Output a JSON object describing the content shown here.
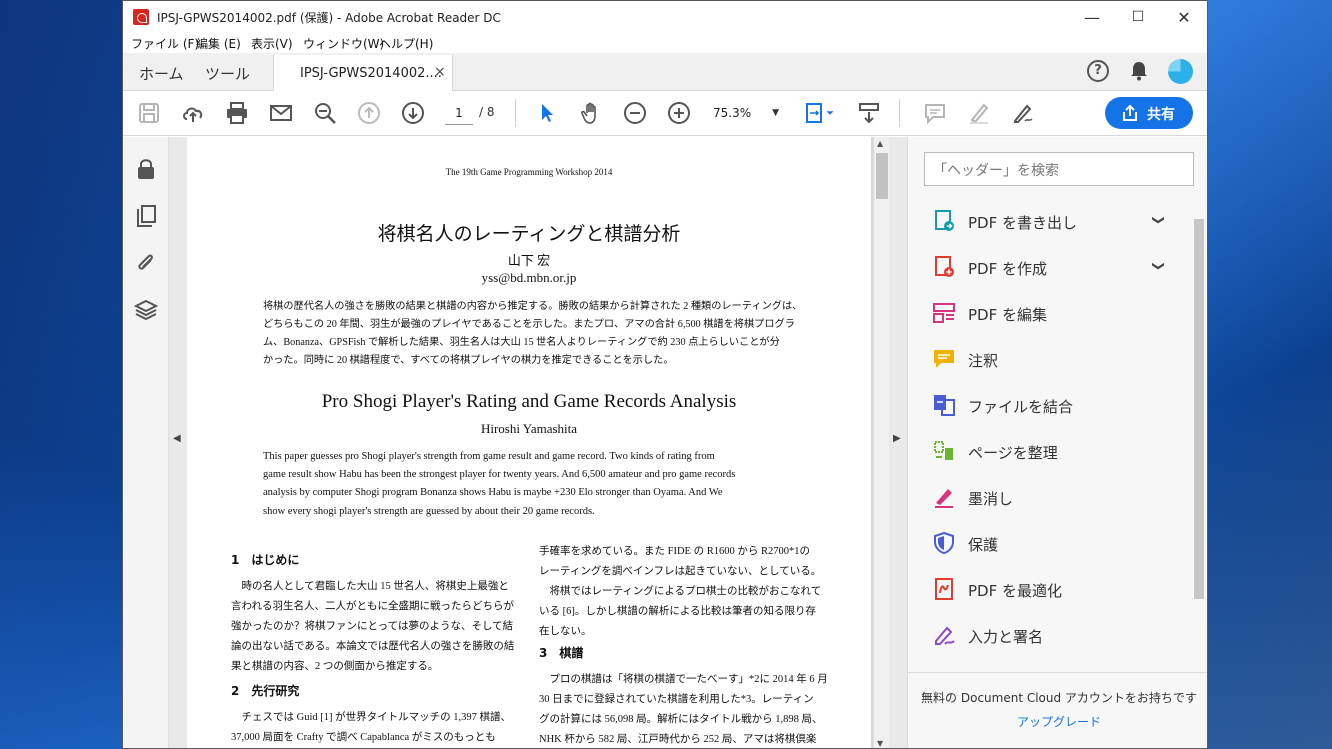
{
  "window": {
    "title": "IPSJ-GPWS2014002.pdf (保護) - Adobe Acrobat Reader DC",
    "controls": {
      "minimize": "—",
      "maximize": "☐",
      "close": "✕"
    }
  },
  "menu": [
    "ファイル (F)",
    "編集 (E)",
    "表示(V)",
    "ウィンドウ(W)",
    "ヘルプ(H)"
  ],
  "tabs": {
    "home": "ホーム",
    "tools": "ツール",
    "document": "IPSJ-GPWS2014002....",
    "close": "×"
  },
  "header_right": {
    "help": "?"
  },
  "toolbar": {
    "page_current": "1",
    "page_total": "/ 8",
    "zoom": "75.3%",
    "zoom_caret": "▼",
    "share_label": "共有"
  },
  "right_pane": {
    "search_placeholder": "「ヘッダー」を検索",
    "items": [
      {
        "label": "PDF を書き出し",
        "icon": "export-pdf-icon",
        "color": "#1a9ba8",
        "expand": "❯"
      },
      {
        "label": "PDF を作成",
        "icon": "create-pdf-icon",
        "color": "#e03c31",
        "expand": "❯"
      },
      {
        "label": "PDF を編集",
        "icon": "edit-pdf-icon",
        "color": "#d6357d"
      },
      {
        "label": "注釈",
        "icon": "comment-icon",
        "color": "#f0b400"
      },
      {
        "label": "ファイルを結合",
        "icon": "combine-files-icon",
        "color": "#4b5bd4"
      },
      {
        "label": "ページを整理",
        "icon": "organize-pages-icon",
        "color": "#6bb52f"
      },
      {
        "label": "墨消し",
        "icon": "redact-icon",
        "color": "#d6357d"
      },
      {
        "label": "保護",
        "icon": "protect-icon",
        "color": "#4b5bd4"
      },
      {
        "label": "PDF を最適化",
        "icon": "optimize-pdf-icon",
        "color": "#e03c31"
      },
      {
        "label": "入力と署名",
        "icon": "fill-sign-icon",
        "color": "#8c4cc9"
      }
    ],
    "footer_text": "無料の Document Cloud アカウントをお持ちです",
    "upgrade": "アップグレード"
  },
  "document": {
    "header": "The 19th Game Programming Workshop 2014",
    "title_jp": "将棋名人のレーティングと棋譜分析",
    "author_jp": "山下 宏",
    "email": "yss@bd.mbn.or.jp",
    "abstract_jp": [
      "将棋の歴代名人の強さを勝敗の結果と棋譜の内容から推定する。勝敗の結果から計算された 2 種類のレーティングは、",
      "どちらもこの 20 年間、羽生が最強のプレイヤであることを示した。またプロ、アマの合計 6,500 棋譜を将棋プログラ",
      "ム、Bonanza、GPSFish で解析した結果、羽生名人は大山 15 世名人よりレーティングで約 230 点上らしいことが分",
      "かった。同時に 20 棋譜程度で、すべての将棋プレイヤの棋力を推定できることを示した。"
    ],
    "title_en": "Pro Shogi Player's Rating and Game Records Analysis",
    "author_en": "Hiroshi Yamashita",
    "abstract_en": [
      "This paper guesses pro Shogi player's strength from game result and game record.  Two kinds of rating from",
      "game result show Habu has been the strongest player for twenty years. And 6,500 amateur and pro game records",
      "analysis by computer Shogi program Bonanza shows Habu is maybe +230 Elo stronger than Oyama.  And We",
      "show every shogi player's strength are guessed by about their 20 game records."
    ],
    "sec1_title": "1　はじめに",
    "sec1_body": [
      "　時の名人として君臨した大山 15 世名人、将棋史上最強と",
      "言われる羽生名人、二人がともに全盛期に戦ったらどちらが",
      "強かったのか？将棋ファンにとっては夢のような、そして結",
      "論の出ない話である。本論文では歴代名人の強さを勝敗の結",
      "果と棋譜の内容、2 つの側面から推定する。"
    ],
    "sec2_title": "2　先行研究",
    "sec2_body": [
      "　チェスでは Guid [1] が世界タイトルマッチの 1,397 棋譜、",
      "37,000 局面を Crafty で調べ Capablanca がミスのもっとも"
    ],
    "col2_top": [
      "手確率を求めている。また FIDE の R1600 から R2700*1の",
      "レーティングを調べインフレは起きていない、としている。",
      "　将棋ではレーティングによるプロ棋士の比較がおこなれて",
      "いる [6]。しかし棋譜の解析による比較は筆者の知る限り存",
      "在しない。"
    ],
    "sec3_title": "3　棋譜",
    "sec3_body": [
      "　プロの棋譜は「将棋の棋譜で一たべーす」*2に 2014 年 6 月",
      "30 日までに登録されていた棋譜を利用した*3。レーティン",
      "グの計算には 56,098 局。解析にはタイトル戦から 1,898 局、",
      "NHK 杯から 582 局、江戸時代から 252 局、アマは将棋倶楽"
    ]
  }
}
